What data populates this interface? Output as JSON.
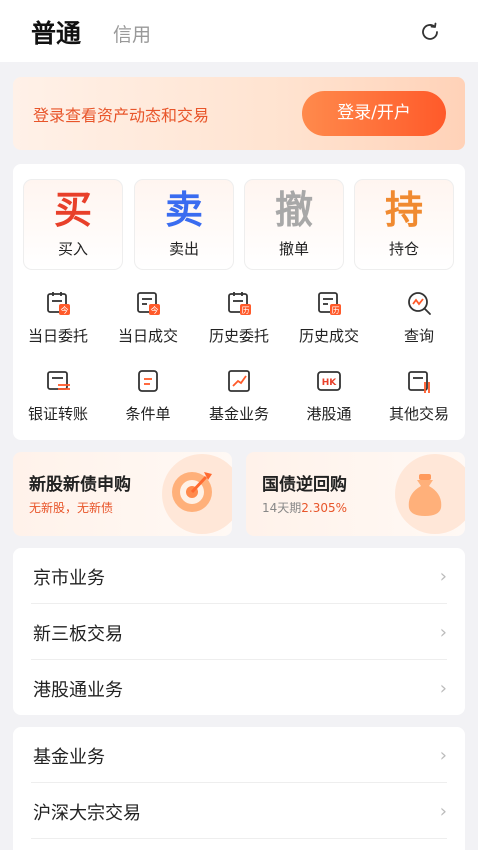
{
  "header": {
    "tab_active": "普通",
    "tab_inactive": "信用",
    "refresh_icon": "refresh-icon"
  },
  "login": {
    "text": "登录查看资产动态和交易",
    "button": "登录/开户"
  },
  "trade_buttons": [
    {
      "char": "买",
      "label": "买入",
      "color": "#e8402a"
    },
    {
      "char": "卖",
      "label": "卖出",
      "color": "#3a6cf0"
    },
    {
      "char": "撤",
      "label": "撤单",
      "color": "#a8a8a8"
    },
    {
      "char": "持",
      "label": "持仓",
      "color": "#f08a30"
    }
  ],
  "grid": [
    {
      "label": "当日委托",
      "icon": "calendar-today-icon"
    },
    {
      "label": "当日成交",
      "icon": "deal-today-icon"
    },
    {
      "label": "历史委托",
      "icon": "calendar-history-icon"
    },
    {
      "label": "历史成交",
      "icon": "deal-history-icon"
    },
    {
      "label": "查询",
      "icon": "search-chart-icon"
    },
    {
      "label": "银证转账",
      "icon": "transfer-icon"
    },
    {
      "label": "条件单",
      "icon": "condition-order-icon"
    },
    {
      "label": "基金业务",
      "icon": "fund-icon"
    },
    {
      "label": "港股通",
      "icon": "hk-icon"
    },
    {
      "label": "其他交易",
      "icon": "other-trade-icon"
    }
  ],
  "icon_badges": {
    "today": "今",
    "history": "历",
    "hk": "HK"
  },
  "promos": [
    {
      "title": "新股新债申购",
      "sub": "无新股，无新债",
      "icon": "target-icon"
    },
    {
      "title": "国债逆回购",
      "sub_prefix": "14天期",
      "sub_value": "2.305%",
      "icon": "money-bag-icon"
    }
  ],
  "menu1": [
    {
      "label": "京市业务"
    },
    {
      "label": "新三板交易"
    },
    {
      "label": "港股通业务"
    }
  ],
  "menu2": [
    {
      "label": "基金业务"
    },
    {
      "label": "沪深大宗交易"
    }
  ],
  "chevron": "›",
  "colors": {
    "accent": "#e8552a",
    "bg": "#f2f2f5"
  }
}
